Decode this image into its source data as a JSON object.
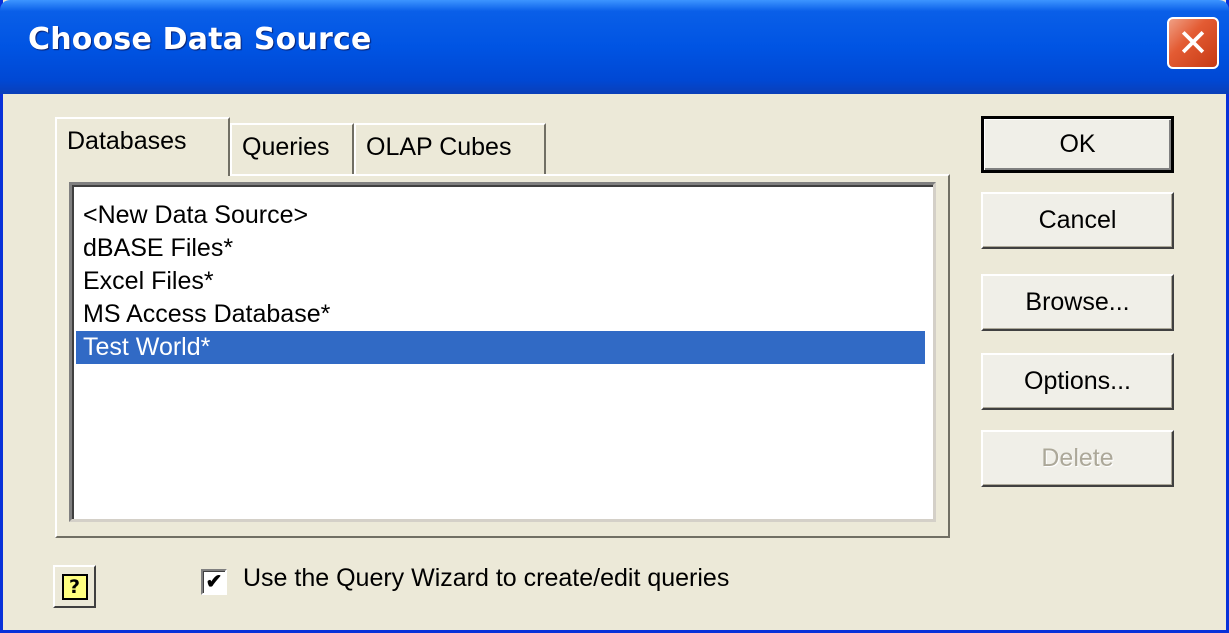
{
  "window": {
    "title": "Choose Data Source"
  },
  "title_buttons": {
    "close": "✕"
  },
  "tabs": [
    {
      "label": "Databases",
      "active": true
    },
    {
      "label": "Queries",
      "active": false
    },
    {
      "label": "OLAP Cubes",
      "active": false
    }
  ],
  "list": {
    "items": [
      "<New Data Source>",
      "dBASE Files*",
      "Excel Files*",
      "MS Access Database*",
      "Test World*"
    ],
    "selected_index": 4
  },
  "buttons": {
    "ok": "OK",
    "cancel": "Cancel",
    "browse": "Browse...",
    "options": "Options...",
    "delete": "Delete"
  },
  "help": {
    "glyph": "?"
  },
  "query_wizard": {
    "checked": true,
    "check_glyph": "✔",
    "label": "Use the Query Wizard to create/edit queries"
  }
}
